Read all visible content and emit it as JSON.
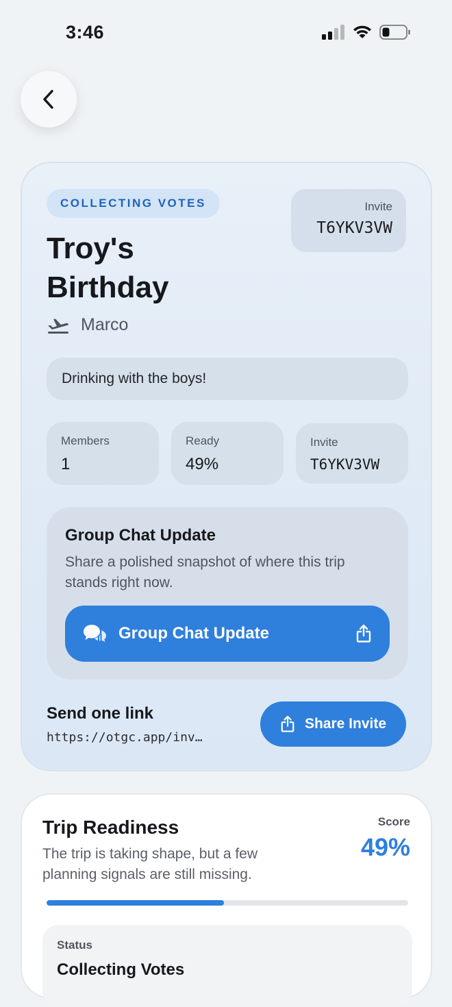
{
  "status_bar": {
    "time": "3:46"
  },
  "header": {
    "back_label": ""
  },
  "trip": {
    "status_pill": "COLLECTING VOTES",
    "invite_label": "Invite",
    "invite_code": "T6YKV3VW",
    "title": "Troy's Birthday",
    "host_name": "Marco",
    "description": "Drinking with the boys!"
  },
  "stats": [
    {
      "label": "Members",
      "value": "1"
    },
    {
      "label": "Ready",
      "value": "49%"
    },
    {
      "label": "Invite",
      "value": "T6YKV3VW"
    }
  ],
  "group_chat": {
    "title": "Group Chat Update",
    "subtitle": "Share a polished snapshot of where this trip stands right now.",
    "button_label": "Group Chat Update"
  },
  "send_link": {
    "title": "Send one link",
    "url": "https://otgc.app/inv…",
    "share_button": "Share Invite"
  },
  "readiness": {
    "title": "Trip Readiness",
    "subtitle": "The trip is taking shape, but a few planning signals are still missing.",
    "score_label": "Score",
    "score_value": "49%",
    "progress": 0.49,
    "status_label": "Status",
    "status_value": "Collecting Votes"
  },
  "colors": {
    "accent": "#2f7fdc",
    "pill_text": "#1f63b8"
  }
}
